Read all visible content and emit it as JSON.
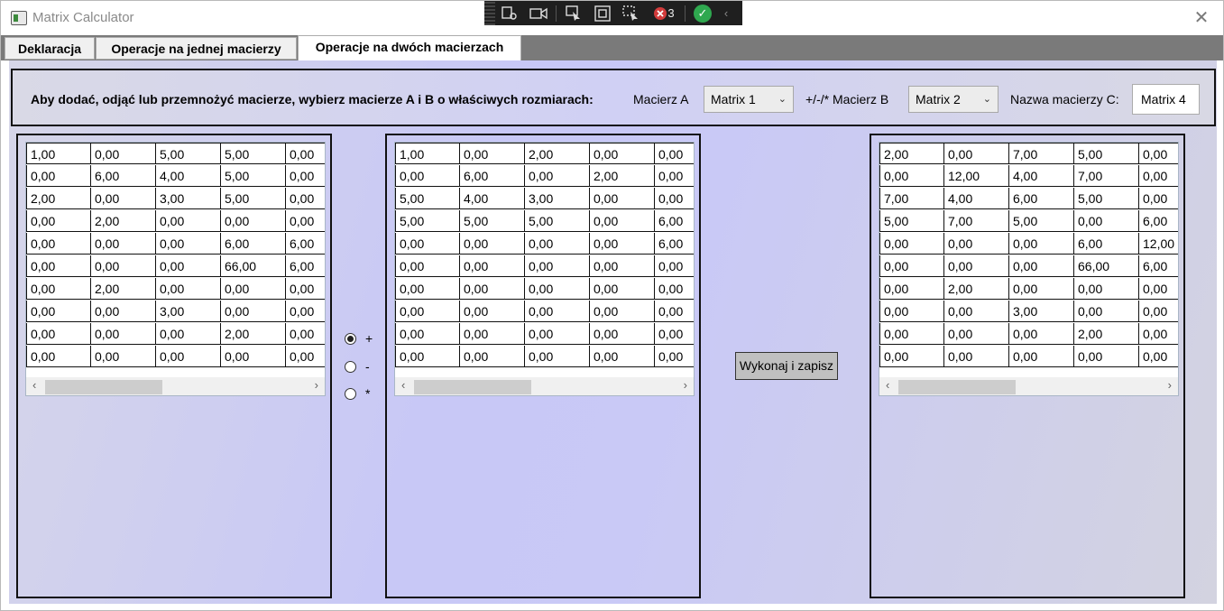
{
  "window": {
    "title": "Matrix Calculator"
  },
  "debug_toolbar": {
    "count": "3"
  },
  "tabs": [
    {
      "label": "Deklaracja"
    },
    {
      "label": "Operacje na jednej macierzy"
    },
    {
      "label": "Operacje na dwóch macierzach"
    }
  ],
  "header": {
    "instruction": "Aby dodać, odjąć lub przemnożyć macierze, wybierz macierze A i B o właściwych rozmiarach:",
    "matrix_a_label": "Macierz A",
    "matrix_a_value": "Matrix 1",
    "operator_label": "+/-/* Macierz B",
    "matrix_b_value": "Matrix 2",
    "result_name_label": "Nazwa macierzy C:",
    "result_name_value": "Matrix 4"
  },
  "operations": [
    {
      "label": "+",
      "checked": true
    },
    {
      "label": "-",
      "checked": false
    },
    {
      "label": "*",
      "checked": false
    }
  ],
  "execute_button": {
    "label": "Wykonaj i zapisz"
  },
  "matrix_a": [
    [
      "1,00",
      "0,00",
      "5,00",
      "5,00",
      "0,00"
    ],
    [
      "0,00",
      "6,00",
      "4,00",
      "5,00",
      "0,00"
    ],
    [
      "2,00",
      "0,00",
      "3,00",
      "5,00",
      "0,00"
    ],
    [
      "0,00",
      "2,00",
      "0,00",
      "0,00",
      "0,00"
    ],
    [
      "0,00",
      "0,00",
      "0,00",
      "6,00",
      "6,00"
    ],
    [
      "0,00",
      "0,00",
      "0,00",
      "66,00",
      "6,00"
    ],
    [
      "0,00",
      "2,00",
      "0,00",
      "0,00",
      "0,00"
    ],
    [
      "0,00",
      "0,00",
      "3,00",
      "0,00",
      "0,00"
    ],
    [
      "0,00",
      "0,00",
      "0,00",
      "2,00",
      "0,00"
    ],
    [
      "0,00",
      "0,00",
      "0,00",
      "0,00",
      "0,00"
    ]
  ],
  "matrix_b": [
    [
      "1,00",
      "0,00",
      "2,00",
      "0,00",
      "0,00"
    ],
    [
      "0,00",
      "6,00",
      "0,00",
      "2,00",
      "0,00"
    ],
    [
      "5,00",
      "4,00",
      "3,00",
      "0,00",
      "0,00"
    ],
    [
      "5,00",
      "5,00",
      "5,00",
      "0,00",
      "6,00"
    ],
    [
      "0,00",
      "0,00",
      "0,00",
      "0,00",
      "6,00"
    ],
    [
      "0,00",
      "0,00",
      "0,00",
      "0,00",
      "0,00"
    ],
    [
      "0,00",
      "0,00",
      "0,00",
      "0,00",
      "0,00"
    ],
    [
      "0,00",
      "0,00",
      "0,00",
      "0,00",
      "0,00"
    ],
    [
      "0,00",
      "0,00",
      "0,00",
      "0,00",
      "0,00"
    ],
    [
      "0,00",
      "0,00",
      "0,00",
      "0,00",
      "0,00"
    ]
  ],
  "matrix_c": [
    [
      "2,00",
      "0,00",
      "7,00",
      "5,00",
      "0,00"
    ],
    [
      "0,00",
      "12,00",
      "4,00",
      "7,00",
      "0,00"
    ],
    [
      "7,00",
      "4,00",
      "6,00",
      "5,00",
      "0,00"
    ],
    [
      "5,00",
      "7,00",
      "5,00",
      "0,00",
      "6,00"
    ],
    [
      "0,00",
      "0,00",
      "0,00",
      "6,00",
      "12,00"
    ],
    [
      "0,00",
      "0,00",
      "0,00",
      "66,00",
      "6,00"
    ],
    [
      "0,00",
      "2,00",
      "0,00",
      "0,00",
      "0,00"
    ],
    [
      "0,00",
      "0,00",
      "3,00",
      "0,00",
      "0,00"
    ],
    [
      "0,00",
      "0,00",
      "0,00",
      "2,00",
      "0,00"
    ],
    [
      "0,00",
      "0,00",
      "0,00",
      "0,00",
      "0,00"
    ]
  ],
  "icons": {
    "close": "close-icon",
    "scroll_left": "chevron-left-icon",
    "scroll_right": "chevron-right-icon",
    "dropdown": "chevron-down-icon"
  }
}
